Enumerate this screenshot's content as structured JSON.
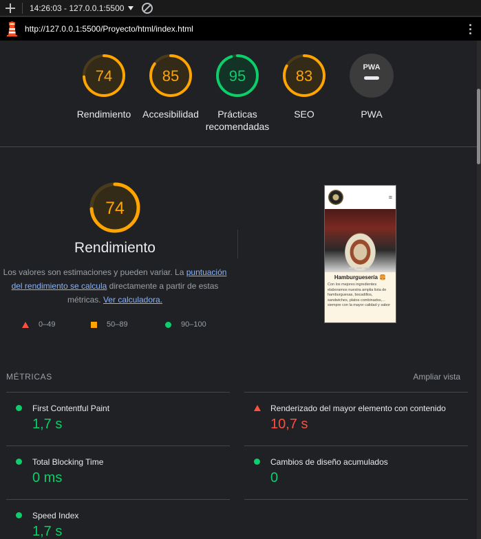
{
  "toolbar": {
    "report_label": "14:26:03 - 127.0.0.1:5500"
  },
  "urlbar": {
    "url": "http://127.0.0.1:5500/Proyecto/html/index.html"
  },
  "gauges": [
    {
      "label": "Rendimiento",
      "score": "74",
      "rating": "average",
      "color": "#ffa400",
      "fraction": 0.74
    },
    {
      "label": "Accesibilidad",
      "score": "85",
      "rating": "average",
      "color": "#ffa400",
      "fraction": 0.85
    },
    {
      "label": "Prácticas recomendadas",
      "score": "95",
      "rating": "pass",
      "color": "#0cce6b",
      "fraction": 0.95
    },
    {
      "label": "SEO",
      "score": "83",
      "rating": "average",
      "color": "#ffa400",
      "fraction": 0.83
    },
    {
      "label": "PWA",
      "badge": "PWA",
      "rating": "na"
    }
  ],
  "performance": {
    "score": "74",
    "fraction": 0.74,
    "title": "Rendimiento",
    "desc_part1": "Los valores son estimaciones y pueden variar. La ",
    "desc_link1": "puntuación del rendimiento se calcula",
    "desc_part2": " directamente a partir de estas métricas. ",
    "desc_link2": "Ver calculadora.",
    "legend": {
      "fail": "0–49",
      "average": "50–89",
      "pass": "90–100"
    }
  },
  "screenshot": {
    "title": "Hamburguesería 🍔",
    "text": "Con los mejores ingredientes elaboramos nuestra amplia lista de hamburguesas, bocadillos, sandwiches, platos combinados,... siempre con la mayor calidad y sabor",
    "menu_icon": "≡"
  },
  "metrics": {
    "header": "MÉTRICAS",
    "expand_label": "Ampliar vista",
    "items": [
      {
        "name": "First Contentful Paint",
        "value": "1,7 s",
        "status": "pass"
      },
      {
        "name": "Renderizado del mayor elemento con contenido",
        "value": "10,7 s",
        "status": "fail"
      },
      {
        "name": "Total Blocking Time",
        "value": "0 ms",
        "status": "pass"
      },
      {
        "name": "Cambios de diseño acumulados",
        "value": "0",
        "status": "pass"
      },
      {
        "name": "Speed Index",
        "value": "1,7 s",
        "status": "pass"
      }
    ]
  },
  "colors": {
    "pass": "#0cce6b",
    "average": "#ffa400",
    "fail": "#ff4e42",
    "link": "#8ab4f8",
    "background": "#202124"
  },
  "icons": [
    "plus-icon",
    "caret-down-icon",
    "clear-icon",
    "lighthouse-icon",
    "kebab-menu-icon",
    "triangle-icon",
    "square-icon",
    "circle-icon"
  ]
}
